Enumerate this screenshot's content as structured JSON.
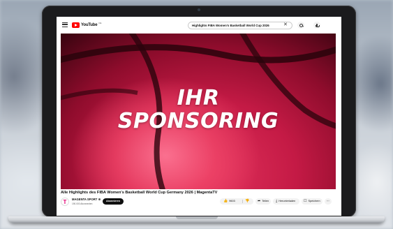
{
  "youtube": {
    "logo_text": "YouTube",
    "country_code": "DE",
    "search_query": "Highlights FIBA Women's Basketball World Cup 2026"
  },
  "video": {
    "overlay_line1": "IHR",
    "overlay_line2": "SPONSORING",
    "title": "Alle Highlights des FIBA Women's Basketball World Cup Germany 2026 | MagentaTV"
  },
  "channel": {
    "avatar_letter": "T",
    "name": "MAGENTA SPORT",
    "subscribers": "190.000 Abonnenten",
    "subscribe_label": "Abonnieren"
  },
  "actions": {
    "likes": "9603",
    "share_label": "Teilen",
    "download_label": "Herunterladen",
    "save_label": "Speichern",
    "more_label": "···"
  },
  "colors": {
    "brand_magenta": "#e20074",
    "youtube_red": "#ff0000",
    "video_red": "#c41a45"
  },
  "icons": [
    "menu-icon",
    "youtube-play-icon",
    "clear-icon",
    "search-icon",
    "mic-icon",
    "verified-icon",
    "like-icon",
    "dislike-icon",
    "share-icon",
    "download-icon",
    "save-icon",
    "more-icon"
  ]
}
